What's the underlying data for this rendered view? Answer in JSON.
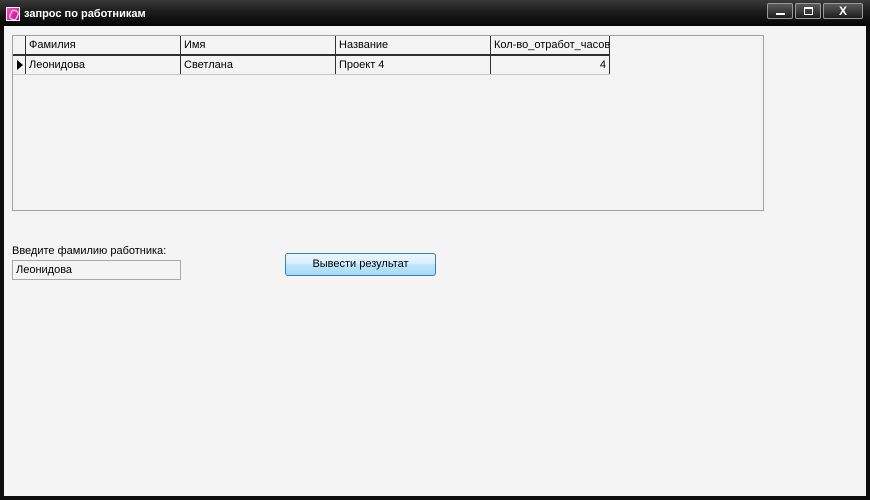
{
  "window": {
    "title": "запрос по работникам",
    "controls": {
      "minimize_icon": "minimize-icon",
      "maximize_icon": "maximize-icon",
      "close_glyph": "X"
    }
  },
  "grid": {
    "columns": [
      "Фамилия",
      "Имя",
      "Название",
      "Кол-во_отработ_часов"
    ],
    "rows": [
      {
        "surname": "Леонидова",
        "name": "Светлана",
        "project": "Проект 4",
        "hours": "4"
      }
    ]
  },
  "search": {
    "label": "Введите фамилию работника:",
    "value": "Леонидова"
  },
  "submit": {
    "label": "Вывести результат"
  },
  "colors": {
    "client_bg": "#f4f4f4",
    "titlebar": "#1c1c1c",
    "button_border": "#3c7fb1",
    "button_fill": "#bee6fd"
  }
}
